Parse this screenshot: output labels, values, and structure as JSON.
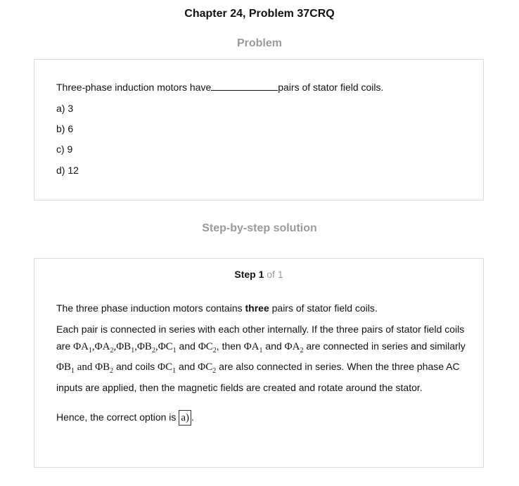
{
  "page_title": "Chapter 24, Problem 37CRQ",
  "problem_heading": "Problem",
  "question": {
    "text_before": "Three-phase induction motors have",
    "text_after": "pairs of stator field coils."
  },
  "options": [
    "a) 3",
    "b) 6",
    "c) 9",
    "d) 12"
  ],
  "solution_heading": "Step-by-step solution",
  "step": {
    "label": "Step 1",
    "of": "of 1"
  },
  "solution": {
    "p1_before": "The three phase induction motors contains ",
    "p1_bold": "three",
    "p1_after": " pairs of stator field coils.",
    "p2_intro": "Each pair is connected in series with each other internally. If the three pairs of stator field coils are ",
    "p2_and": " and ",
    "p2_then": ", then ",
    "p2_and2": " and ",
    "p2_series": " are connected in series and similarly ",
    "p2_and3": " and ",
    "p2_coils": " and coils ",
    "p2_and4": " and ",
    "p2_end": " are also connected in series. When the three phase AC inputs are applied, then the magnetic fields are created and rotate around the stator.",
    "p3_before": "Hence, the correct option is ",
    "answer": "a)",
    "p3_after": "."
  }
}
